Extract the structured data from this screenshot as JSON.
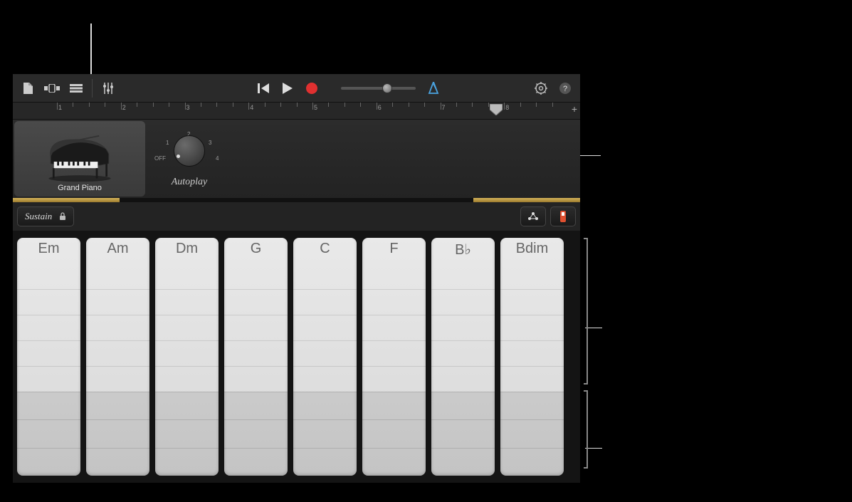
{
  "instrument": {
    "name": "Grand Piano"
  },
  "autoplay": {
    "label": "Autoplay",
    "positions": {
      "off": "OFF",
      "p1": "1",
      "p2": "2",
      "p3": "3",
      "p4": "4"
    }
  },
  "sustain": {
    "label": "Sustain"
  },
  "ruler": {
    "bars": [
      "1",
      "2",
      "3",
      "4",
      "5",
      "6",
      "7",
      "8"
    ]
  },
  "chords": [
    "Em",
    "Am",
    "Dm",
    "G",
    "C",
    "F",
    "B♭",
    "Bdim"
  ],
  "icons": {
    "browser": "browser-icon",
    "tracks": "tracks-icon",
    "fx": "fx-icon",
    "mixer": "mixer-icon",
    "rewind": "rewind-icon",
    "play": "play-icon",
    "record": "record-icon",
    "metronome": "metronome-icon",
    "settings": "settings-icon",
    "help": "help-icon",
    "lock": "lock-icon",
    "scale": "scale-icon",
    "keyboard": "keyboard-icon",
    "plus": "+"
  }
}
